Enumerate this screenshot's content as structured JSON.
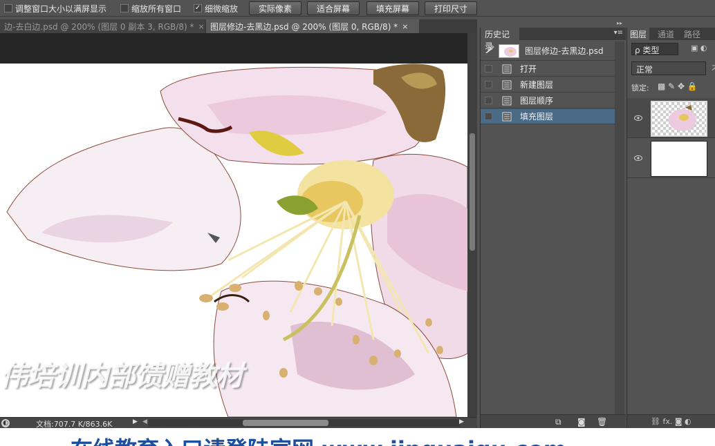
{
  "options": {
    "resize_windows": "调整窗口大小以满屏显示",
    "zoom_all": "缩放所有窗口",
    "scrubby_zoom": "细微缩放",
    "btn_actual": "实际像素",
    "btn_fit": "适合屏幕",
    "btn_fill": "填充屏幕",
    "btn_print": "打印尺寸",
    "check_mark": "✓"
  },
  "tabs": [
    {
      "label": "边-去白边.psd @ 200% (图层 0 副本 3, RGB/8) *",
      "close": "×"
    },
    {
      "label": "图层修边-去黑边.psd @ 200% (图层 0, RGB/8) *",
      "close": "×"
    }
  ],
  "canvas": {
    "watermark": "伟培训内部馈赠教材"
  },
  "status": {
    "doc_info": "文档:707.7 K/863.6K",
    "icon": "◐",
    "arrow": "▶",
    "arrow_left": "◀",
    "arrow_right": "▶"
  },
  "history": {
    "title": "历史记录",
    "menu": "▾≡",
    "snapshot": "图层修边-去黑边.psd",
    "items": [
      "打开",
      "新建图层",
      "图层顺序",
      "填充图层"
    ],
    "footer_icons": [
      "⧉",
      "◙",
      "🗑"
    ]
  },
  "layers": {
    "tabs": [
      "图层",
      "通道",
      "路径"
    ],
    "filter": "ρ 类型",
    "filter_icons": "▣ ◐",
    "blend": "正常",
    "opacity_label": "不",
    "lock_label": "锁定:",
    "lock_icons": "▩ ✎ ✥ 🔒",
    "eye": "👁",
    "footer_icons": "⛓ fx. ◙ ◐"
  },
  "collapse": "▸▸",
  "banner": {
    "text": "在线教育入口请登陆官网 www.jinguaiqu.com"
  }
}
